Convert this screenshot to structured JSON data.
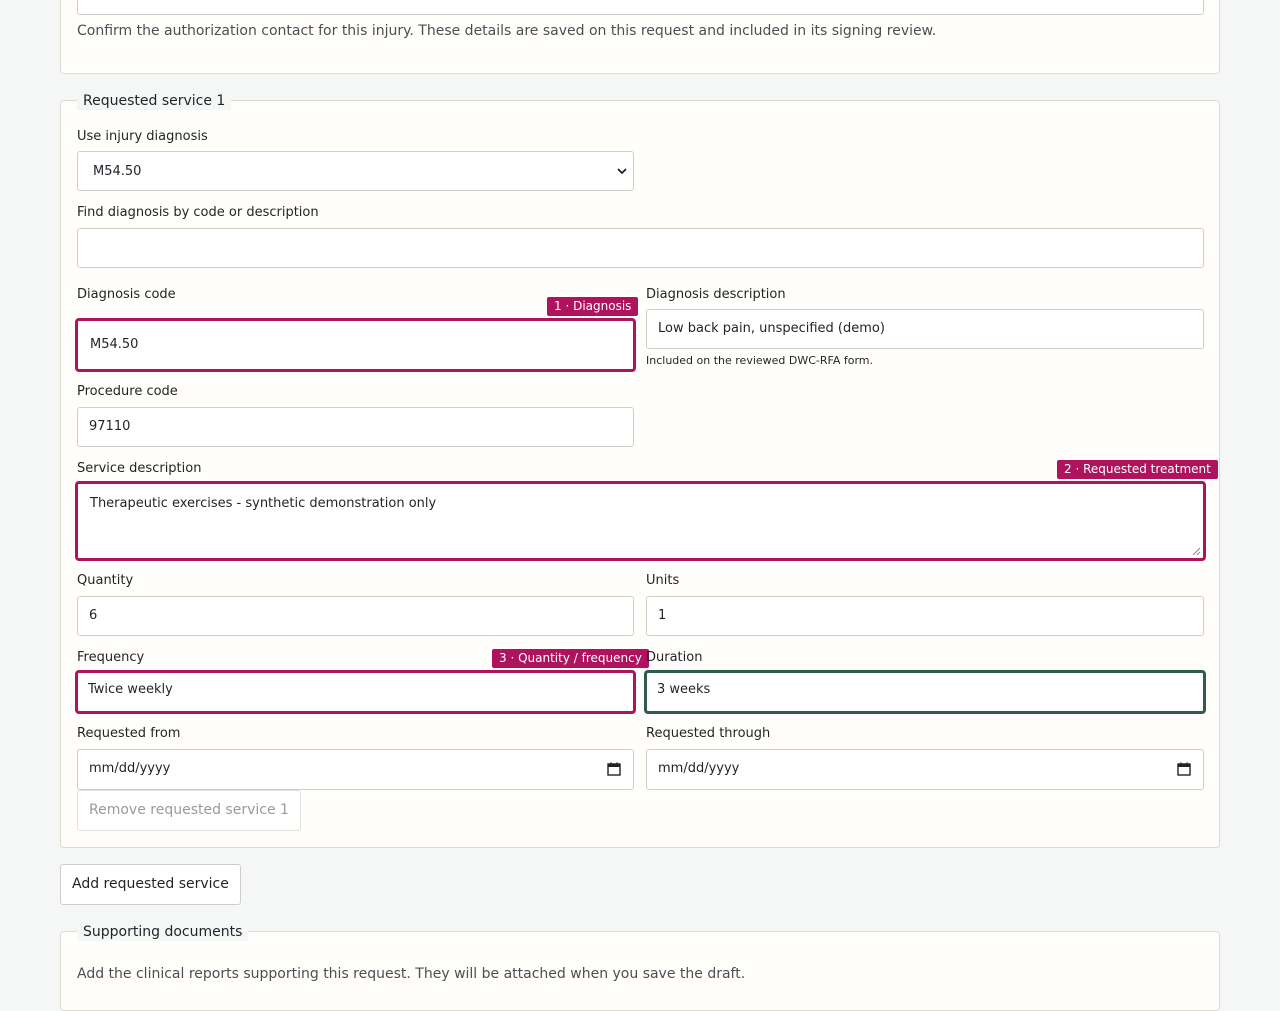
{
  "authorization": {
    "helper_text": "Confirm the authorization contact for this injury. These details are saved on this request and included in its signing review."
  },
  "service": {
    "legend": "Requested service 1",
    "injury_diagnosis": {
      "label": "Use injury diagnosis",
      "selected": "M54.50"
    },
    "find_diagnosis": {
      "label": "Find diagnosis by code or description",
      "value": ""
    },
    "diagnosis_code": {
      "label": "Diagnosis code",
      "value": "M54.50",
      "badge": "1 · Diagnosis"
    },
    "diagnosis_description": {
      "label": "Diagnosis description",
      "value": "Low back pain, unspecified (demo)",
      "note": "Included on the reviewed DWC-RFA form."
    },
    "procedure_code": {
      "label": "Procedure code",
      "value": "97110"
    },
    "service_description": {
      "label": "Service description",
      "value": "Therapeutic exercises - synthetic demonstration only",
      "badge": "2 · Requested treatment"
    },
    "quantity": {
      "label": "Quantity",
      "value": "6"
    },
    "units": {
      "label": "Units",
      "value": "1"
    },
    "frequency": {
      "label": "Frequency",
      "value": "Twice weekly",
      "badge": "3 · Quantity / frequency"
    },
    "duration": {
      "label": "Duration",
      "value": "3 weeks"
    },
    "requested_from": {
      "label": "Requested from",
      "placeholder": "mm/dd/yyyy"
    },
    "requested_through": {
      "label": "Requested through",
      "placeholder": "mm/dd/yyyy"
    },
    "remove_button": "Remove requested service 1"
  },
  "add_service_button": "Add requested service",
  "supporting": {
    "legend": "Supporting documents",
    "helper_text": "Add the clinical reports supporting this request. They will be attached when you save the draft."
  },
  "icons": {
    "select": "chevron-down-icon",
    "date": "calendar-icon"
  },
  "colors": {
    "highlight": "#b0135e",
    "focus": "#2f5b50",
    "page_background": "#f5f7f6",
    "card_background": "#fffefa"
  }
}
